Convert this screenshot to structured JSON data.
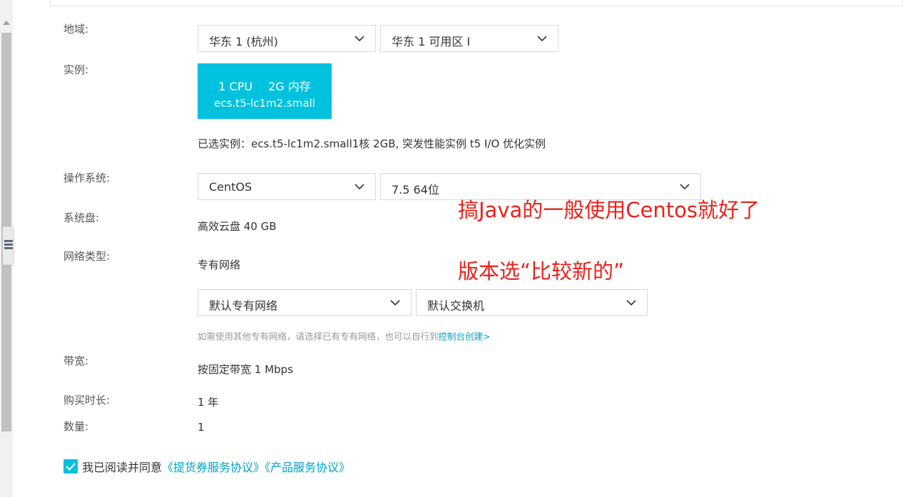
{
  "form": {
    "region": {
      "label": "地域:",
      "region_select": "华东 1 (杭州)",
      "zone_select": "华东 1 可用区 I"
    },
    "instance": {
      "label": "实例:",
      "card": {
        "cpu": "1 CPU",
        "memory": "2G 内存",
        "name": "ecs.t5-lc1m2.small"
      },
      "selected_text": "已选实例：ecs.t5-lc1m2.small1核 2GB, 突发性能实例 t5 I/O 优化实例"
    },
    "os": {
      "label": "操作系统:",
      "os_select": "CentOS",
      "version_select": "7.5 64位"
    },
    "disk": {
      "label": "系统盘:",
      "value": "高效云盘 40 GB"
    },
    "network": {
      "label": "网络类型:",
      "value": "专有网络",
      "vpc_select": "默认专有网络",
      "vswitch_select": "默认交换机",
      "hint": "如需使用其他专有网络，请选择已有专有网络，也可以自行到",
      "hint_link": "控制台创建>"
    },
    "bandwidth": {
      "label": "带宽:",
      "value": "按固定带宽 1 Mbps"
    },
    "duration": {
      "label": "购买时长:",
      "value": "1 年"
    },
    "quantity": {
      "label": "数量:",
      "value": "1"
    },
    "agreement": {
      "checked": true,
      "text": "我已阅读并同意",
      "link1": "《提货券服务协议》",
      "link2": "《产品服务协议》"
    }
  },
  "annotations": {
    "note1": "搞Java的一般使用Centos就好了",
    "note2": "版本选“比较新的”"
  },
  "colors": {
    "accent": "#00c1de",
    "link": "#00a2ca",
    "annotation": "#e8221b"
  },
  "icons": [
    "chevron-down-icon",
    "check-icon",
    "list-icon",
    "scroll-up-arrow-icon"
  ]
}
